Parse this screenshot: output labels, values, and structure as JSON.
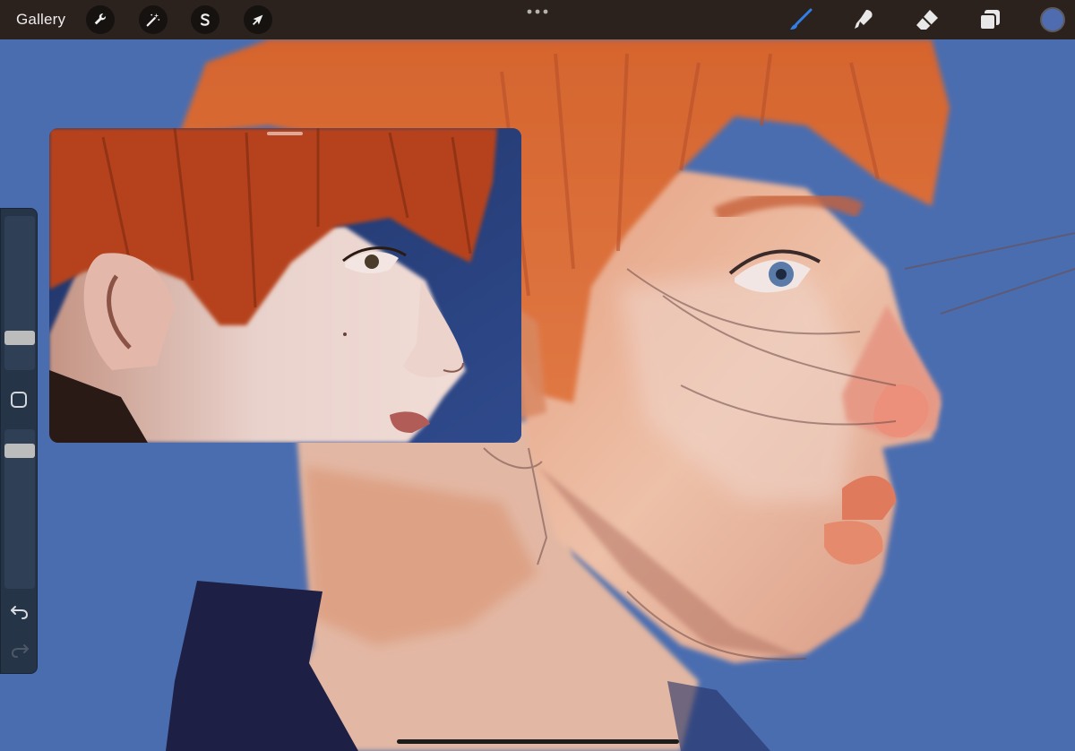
{
  "toolbar": {
    "gallery_label": "Gallery",
    "left_tools": [
      {
        "name": "actions",
        "icon": "wrench-icon"
      },
      {
        "name": "adjustments",
        "icon": "magic-wand-icon"
      },
      {
        "name": "selection",
        "icon": "selection-s-icon"
      },
      {
        "name": "transform",
        "icon": "arrow-cursor-icon"
      }
    ],
    "more_icon": "more-dots-icon",
    "right_tools": [
      {
        "name": "brush",
        "icon": "brush-icon",
        "active": true
      },
      {
        "name": "smudge",
        "icon": "smudge-icon",
        "active": false
      },
      {
        "name": "eraser",
        "icon": "eraser-icon",
        "active": false
      },
      {
        "name": "layers",
        "icon": "layers-icon",
        "active": false
      }
    ],
    "current_color": "#4f6cb0"
  },
  "sidebar": {
    "brush_size_level": 0.18,
    "opacity_level": 0.9,
    "modify_icon": "square-icon",
    "undo_icon": "undo-icon",
    "redo_icon": "redo-icon"
  },
  "reference": {
    "description_icon": "reference-photo"
  },
  "colors": {
    "toolbar_bg": "#2b211d",
    "canvas_bg": "#4a6db0",
    "hair": "#d9642f",
    "skin": "#e9b49a",
    "brush_active": "#2f7fe6"
  }
}
